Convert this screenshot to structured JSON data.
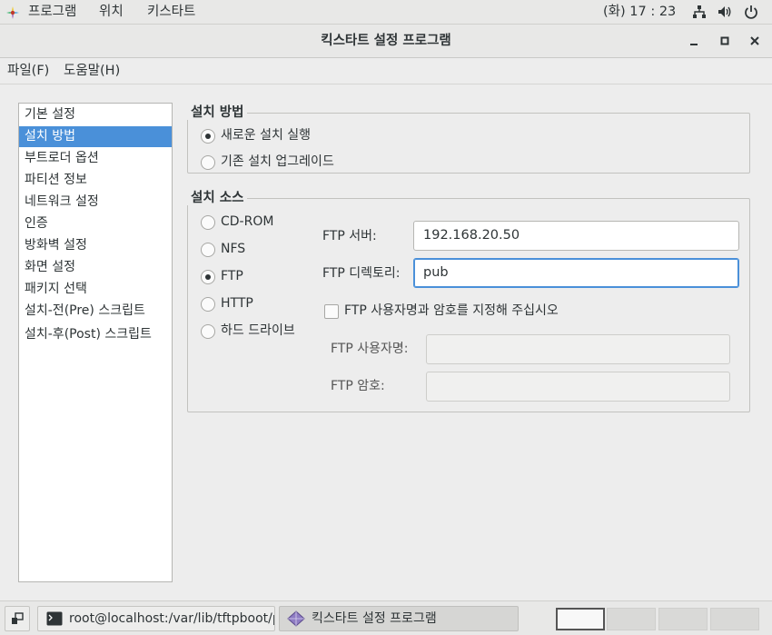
{
  "top_panel": {
    "menus": [
      "프로그램",
      "위치",
      "키스타트"
    ],
    "clock": "(화) 17 : 23"
  },
  "window": {
    "title": "킥스타트 설정 프로그램"
  },
  "menubar": {
    "items": [
      "파일(F)",
      "도움말(H)"
    ]
  },
  "sidebar": {
    "items": [
      {
        "label": "기본 설정"
      },
      {
        "label": "설치 방법",
        "selected": true
      },
      {
        "label": "부트로더 옵션"
      },
      {
        "label": "파티션 정보"
      },
      {
        "label": "네트워크 설정"
      },
      {
        "label": "인증"
      },
      {
        "label": "방화벽 설정"
      },
      {
        "label": "화면 설정"
      },
      {
        "label": "패키지 선택"
      },
      {
        "label": "설치-전(Pre) 스크립트"
      },
      {
        "label": "설치-후(Post) 스크립트"
      }
    ]
  },
  "install_method": {
    "title": "설치 방법",
    "options": [
      {
        "label": "새로운 설치 실행",
        "selected": true
      },
      {
        "label": "기존 설치 업그레이드",
        "selected": false
      }
    ]
  },
  "install_source": {
    "title": "설치 소스",
    "options": [
      {
        "label": "CD-ROM",
        "selected": false
      },
      {
        "label": "NFS",
        "selected": false
      },
      {
        "label": "FTP",
        "selected": true
      },
      {
        "label": "HTTP",
        "selected": false
      },
      {
        "label": "하드 드라이브",
        "selected": false
      }
    ],
    "ftp_server_label": "FTP 서버:",
    "ftp_server_value": "192.168.20.50",
    "ftp_dir_label": "FTP 디렉토리:",
    "ftp_dir_value": "pub",
    "ftp_auth_checkbox_label": "FTP 사용자명과 암호를 지정해 주십시오",
    "ftp_auth_checked": false,
    "ftp_user_label": "FTP 사용자명:",
    "ftp_user_value": "",
    "ftp_pass_label": "FTP 암호:",
    "ftp_pass_value": ""
  },
  "taskbar": {
    "terminal_label": "root@localhost:/var/lib/tftpboot/px…",
    "kickstart_label": "킥스타트 설정 프로그램",
    "workspaces": 4,
    "active_workspace": 1
  }
}
